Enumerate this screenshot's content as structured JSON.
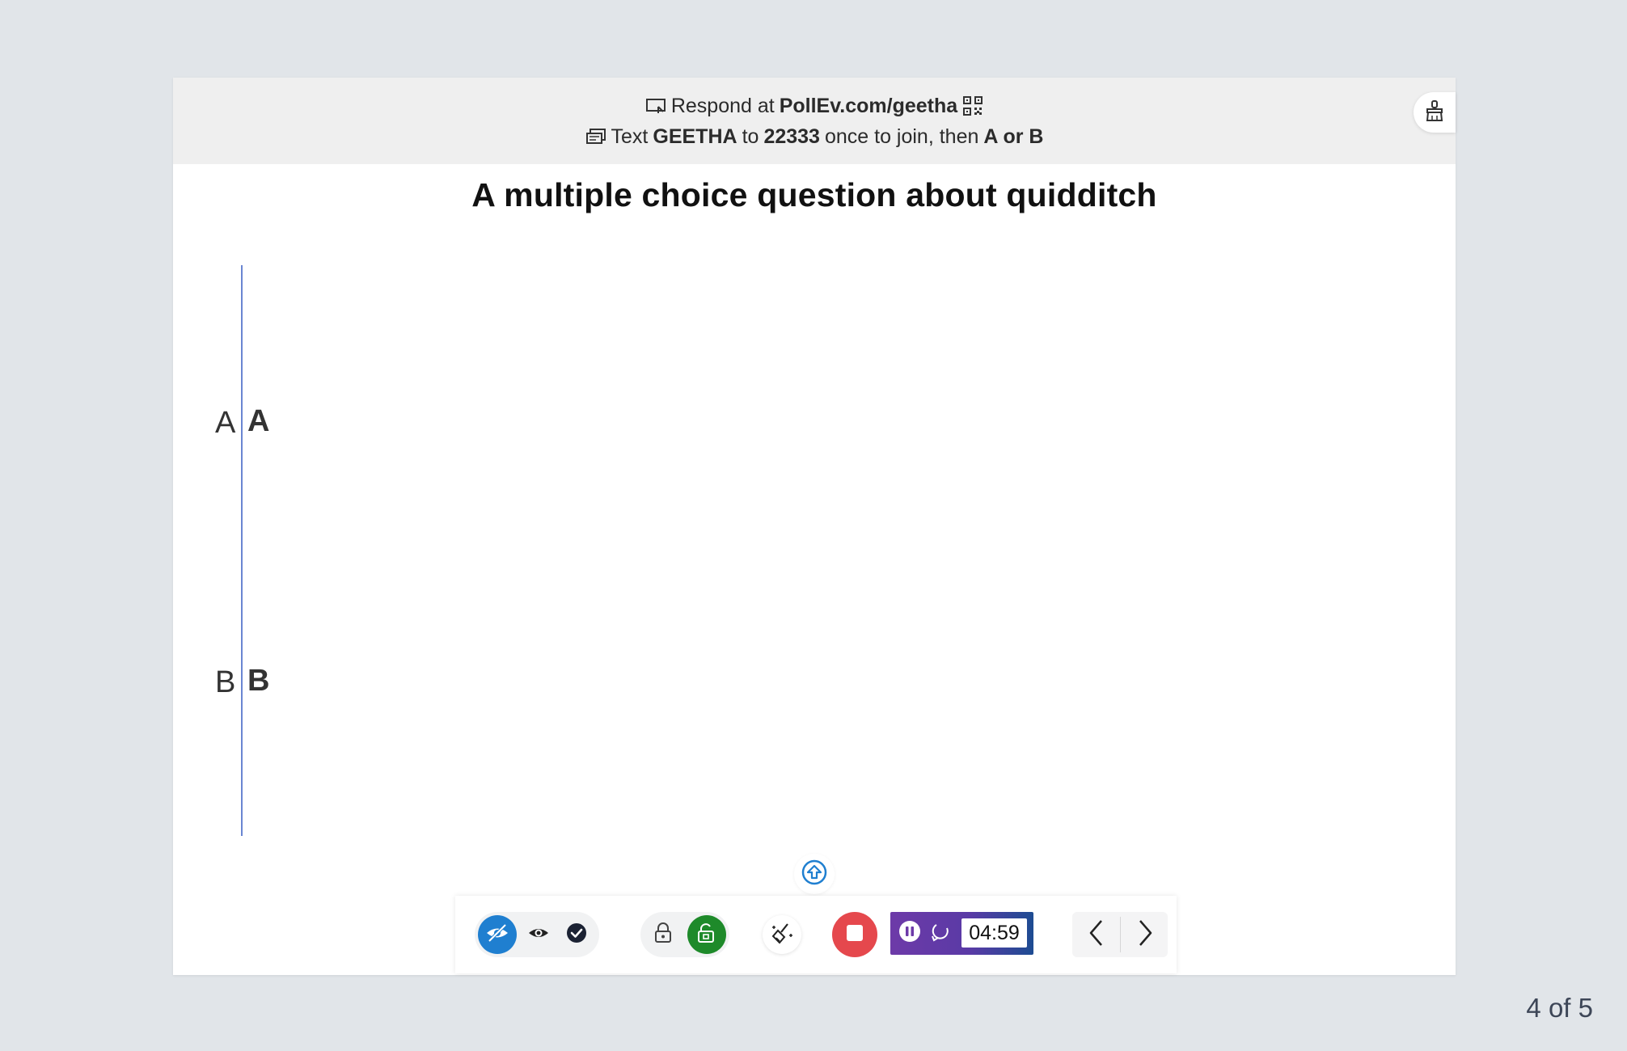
{
  "banner": {
    "respond_prefix": "Respond at",
    "respond_url": "PollEv.com/geetha",
    "text_prefix": "Text",
    "keyword": "GEETHA",
    "to_word": "to",
    "number": "22333",
    "join_text": "once to join, then",
    "choices": "A or B"
  },
  "question": {
    "title": "A multiple choice question about quidditch"
  },
  "chart_data": {
    "type": "bar",
    "categories": [
      "A",
      "B"
    ],
    "option_labels": [
      "A",
      "B"
    ],
    "values": [
      0,
      0
    ]
  },
  "timer": {
    "value": "04:59"
  },
  "pagination": {
    "label": "4 of 5"
  },
  "colors": {
    "axis": "#6a86d2",
    "hide_responses_active": "#1f7fd0",
    "unlock_active": "#1e8a2a",
    "stop": "#e5484d",
    "timer_gradient_start": "#6d3aa8",
    "timer_gradient_end": "#1d4c92"
  },
  "icons": {
    "present": "screen-icon",
    "qr": "qr-code-icon",
    "sms": "sms-icon",
    "corner": "clear-responses-icon",
    "up": "upload-arrow-icon"
  }
}
